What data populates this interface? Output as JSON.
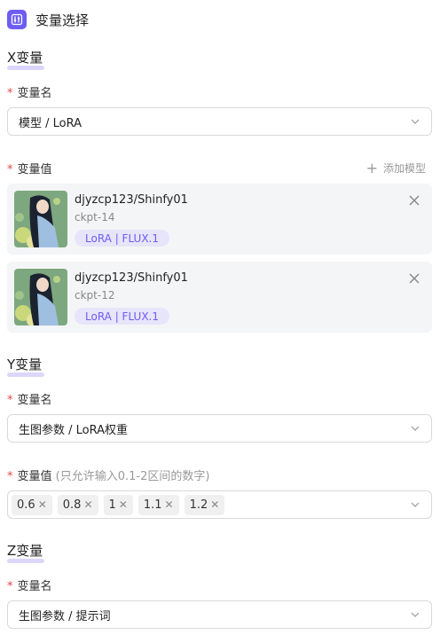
{
  "header": {
    "title": "变量选择"
  },
  "x_section": {
    "title": "X变量",
    "name_label": "变量名",
    "name_value": "模型 / LoRA",
    "value_label": "变量值",
    "add_model": "添加模型",
    "models": [
      {
        "name": "djyzcp123/Shinfy01",
        "sub": "ckpt-14",
        "tag": "LoRA | FLUX.1"
      },
      {
        "name": "djyzcp123/Shinfy01",
        "sub": "ckpt-12",
        "tag": "LoRA | FLUX.1"
      }
    ]
  },
  "y_section": {
    "title": "Y变量",
    "name_label": "变量名",
    "name_value": "生图参数 / LoRA权重",
    "value_label": "变量值",
    "value_hint": "(只允许输入0.1-2区间的数字)",
    "chips": [
      "0.6",
      "0.8",
      "1",
      "1.1",
      "1.2"
    ]
  },
  "z_section": {
    "title": "Z变量",
    "name_label": "变量名",
    "name_value": "生图参数 / 提示词"
  },
  "colors": {
    "accent": "#6d5df2",
    "required": "#e64545"
  }
}
